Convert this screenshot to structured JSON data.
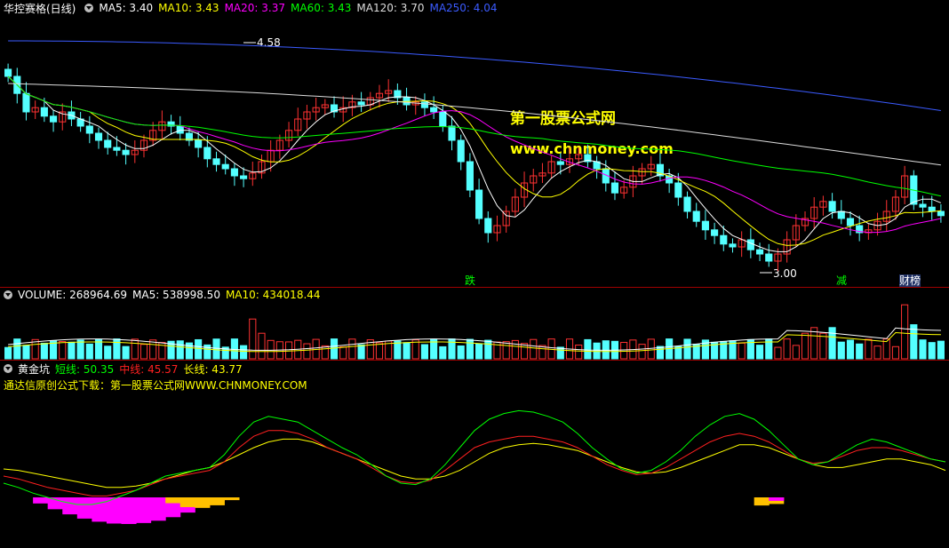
{
  "window": {
    "stock_title": "华控赛格(日线)",
    "price_pane": {
      "ma_labels": [
        {
          "name": "MA5",
          "value": "MA5: 3.40",
          "color": "#ffffff"
        },
        {
          "name": "MA10",
          "value": "MA10: 3.43",
          "color": "#ffff00"
        },
        {
          "name": "MA20",
          "value": "MA20: 3.37",
          "color": "#ff00ff"
        },
        {
          "name": "MA60",
          "value": "MA60: 3.43",
          "color": "#00ff00"
        },
        {
          "name": "MA120",
          "value": "MA120: 3.70",
          "color": "#dddddd"
        },
        {
          "name": "MA250",
          "value": "MA250: 4.04",
          "color": "#3b5bff"
        }
      ],
      "high_label": "4.58",
      "low_label": "3.00",
      "markers": [
        {
          "text": "跌",
          "color": "#00ff00"
        },
        {
          "text": "减",
          "color": "#00ff00"
        },
        {
          "text": "财",
          "color": "#ffffff"
        },
        {
          "text": "榜",
          "color": "#ffffff"
        }
      ],
      "watermark_cn": "第一股票公式网",
      "watermark_url": "www.chnmoney.com"
    },
    "volume_pane": {
      "label_volume": "VOLUME: 268964.69",
      "label_ma5": "MA5: 538998.50",
      "label_ma10": "MA10: 434018.44"
    },
    "indicator_pane": {
      "name": "黄金坑",
      "short_label": "短线: 50.35",
      "mid_label": "中线: 45.57",
      "long_label": "长线: 43.77",
      "source_note": "通达信原创公式下载：第一股票公式网WWW.CHNMONEY.COM"
    }
  },
  "colors": {
    "up": "#ff3232",
    "down": "#54ffff",
    "separator": "#a00000",
    "short": "#00ff00",
    "mid": "#ff2020",
    "long": "#ffff00",
    "fill_magenta": "#ff00ff",
    "fill_gold": "#ffc000"
  },
  "chart_data": [
    {
      "type": "candlestick",
      "series": [
        {
          "name": "MA5",
          "values": [
            3.4
          ]
        },
        {
          "name": "MA10",
          "values": [
            3.43
          ]
        },
        {
          "name": "MA20",
          "values": [
            3.37
          ]
        },
        {
          "name": "MA60",
          "values": [
            3.43
          ]
        },
        {
          "name": "MA120",
          "values": [
            3.7
          ]
        },
        {
          "name": "MA250",
          "values": [
            4.04
          ]
        }
      ],
      "annotations": [
        {
          "text": "4.58",
          "kind": "high"
        },
        {
          "text": "3.00",
          "kind": "low"
        }
      ],
      "closes": [
        4.3,
        4.18,
        4.05,
        4.08,
        4.02,
        3.98,
        4.05,
        4.0,
        3.95,
        3.9,
        3.85,
        3.8,
        3.78,
        3.75,
        3.78,
        3.85,
        3.92,
        3.98,
        3.95,
        3.9,
        3.85,
        3.8,
        3.72,
        3.68,
        3.65,
        3.6,
        3.58,
        3.62,
        3.7,
        3.78,
        3.85,
        3.92,
        4.0,
        4.05,
        4.08,
        4.1,
        4.05,
        4.08,
        4.12,
        4.1,
        4.15,
        4.18,
        4.2,
        4.15,
        4.1,
        4.12,
        4.08,
        4.05,
        3.95,
        3.85,
        3.7,
        3.5,
        3.3,
        3.2,
        3.25,
        3.35,
        3.45,
        3.55,
        3.6,
        3.62,
        3.7,
        3.68,
        3.72,
        3.75,
        3.7,
        3.65,
        3.55,
        3.48,
        3.52,
        3.6,
        3.65,
        3.68,
        3.6,
        3.55,
        3.45,
        3.35,
        3.28,
        3.22,
        3.18,
        3.12,
        3.1,
        3.15,
        3.08,
        3.05,
        3.0,
        3.05,
        3.15,
        3.25,
        3.3,
        3.38,
        3.42,
        3.35,
        3.3,
        3.25,
        3.2,
        3.22,
        3.28,
        3.35,
        3.45,
        3.6,
        3.4,
        3.38,
        3.35,
        3.32
      ]
    },
    {
      "type": "bar",
      "series": [
        {
          "name": "VOLUME",
          "values": [
            268964.69
          ]
        },
        {
          "name": "MA5",
          "values": [
            538998.5
          ]
        },
        {
          "name": "MA10",
          "values": [
            434018.44
          ]
        }
      ]
    },
    {
      "type": "line",
      "series": [
        {
          "name": "短线",
          "values": [
            35,
            32,
            28,
            25,
            22,
            20,
            20,
            22,
            26,
            30,
            35,
            40,
            42,
            44,
            46,
            55,
            68,
            78,
            82,
            80,
            78,
            72,
            66,
            60,
            55,
            48,
            40,
            35,
            34,
            38,
            48,
            60,
            72,
            80,
            84,
            86,
            85,
            82,
            78,
            70,
            60,
            52,
            45,
            42,
            44,
            50,
            58,
            68,
            76,
            82,
            84,
            80,
            72,
            62,
            52,
            48,
            50,
            56,
            62,
            66,
            64,
            60,
            56,
            52,
            50
          ]
        },
        {
          "name": "中线",
          "values": [
            40,
            38,
            35,
            32,
            30,
            28,
            26,
            26,
            28,
            30,
            34,
            38,
            40,
            42,
            44,
            50,
            60,
            68,
            72,
            72,
            70,
            66,
            60,
            56,
            52,
            46,
            40,
            36,
            35,
            37,
            44,
            52,
            60,
            64,
            66,
            68,
            68,
            66,
            64,
            60,
            54,
            48,
            44,
            41,
            42,
            46,
            52,
            58,
            64,
            68,
            70,
            68,
            64,
            58,
            52,
            49,
            50,
            54,
            58,
            60,
            60,
            58,
            55,
            52,
            50
          ]
        },
        {
          "name": "长线",
          "values": [
            45,
            44,
            42,
            40,
            38,
            36,
            34,
            32,
            32,
            33,
            35,
            38,
            41,
            44,
            46,
            50,
            55,
            60,
            64,
            66,
            66,
            64,
            60,
            56,
            52,
            48,
            44,
            40,
            38,
            38,
            40,
            44,
            50,
            56,
            60,
            62,
            63,
            62,
            60,
            58,
            54,
            50,
            46,
            43,
            42,
            43,
            46,
            50,
            54,
            58,
            62,
            62,
            60,
            56,
            52,
            48,
            46,
            46,
            48,
            50,
            52,
            52,
            50,
            48,
            44
          ]
        }
      ]
    }
  ]
}
